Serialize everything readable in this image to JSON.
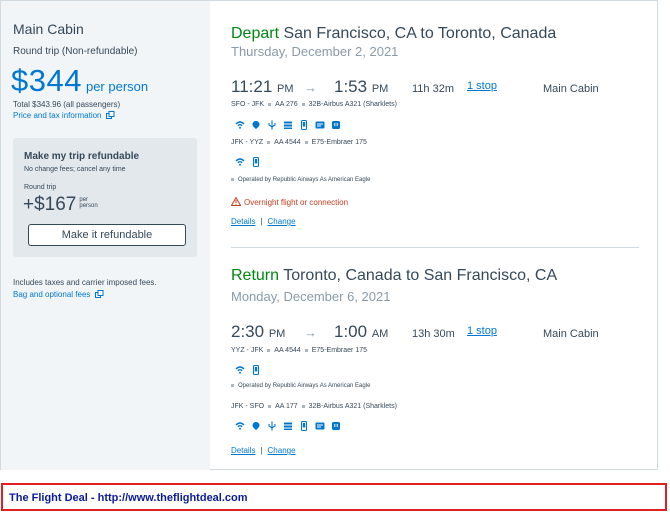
{
  "summary": {
    "cabin_title": "Main Cabin",
    "trip_type": "Round trip (Non-refundable)",
    "price": "$344",
    "per_person": "per person",
    "total": "Total $343.96 (all passengers)",
    "tax_link": "Price and tax information",
    "includes": "Includes taxes and carrier imposed fees.",
    "bag_link": "Bag and optional fees"
  },
  "refund": {
    "title": "Make my trip refundable",
    "subtitle": "No change fees; cancel any time",
    "round_trip": "Round trip",
    "price": "+$167",
    "per_line1": "per",
    "per_line2": "person",
    "button": "Make it refundable"
  },
  "depart": {
    "label": "Depart",
    "route": "San Francisco, CA to Toronto, Canada",
    "date": "Thursday, December 2, 2021",
    "dep_time": "11:21",
    "dep_ampm": "PM",
    "arrow": "→",
    "arr_time": "1:53",
    "arr_ampm": "PM",
    "duration": "11h 32m",
    "stops": "1 stop",
    "cabin": "Main Cabin",
    "leg1": {
      "route": "SFO - JFK",
      "flight": "AA 276",
      "aircraft": "32B-Airbus A321 (Sharklets)"
    },
    "leg2": {
      "route": "JFK - YYZ",
      "flight": "AA 4544",
      "aircraft": "E75-Embraer 175"
    },
    "operated": "Operated by Republic Airways As American Eagle",
    "warning": "Overnight flight or connection",
    "details": "Details",
    "change": "Change",
    "sep": "|"
  },
  "return": {
    "label": "Return",
    "route": "Toronto, Canada to San Francisco, CA",
    "date": "Monday, December 6, 2021",
    "dep_time": "2:30",
    "dep_ampm": "PM",
    "arrow": "→",
    "arr_time": "1:00",
    "arr_ampm": "AM",
    "duration": "13h 30m",
    "stops": "1 stop",
    "cabin": "Main Cabin",
    "leg1": {
      "route": "YYZ - JFK",
      "flight": "AA 4544",
      "aircraft": "E75-Embraer 175"
    },
    "operated": "Operated by Republic Airways As American Eagle",
    "leg2": {
      "route": "JFK - SFO",
      "flight": "AA 177",
      "aircraft": "32B-Airbus A321 (Sharklets)"
    },
    "details": "Details",
    "change": "Change",
    "sep": "|"
  },
  "footer": {
    "text": "The Flight Deal - http://www.theflightdeal.com"
  },
  "colors": {
    "brand_blue": "#0078d2",
    "accent_green": "#008712",
    "warning_red": "#c63e1f",
    "footer_red": "#e02020"
  }
}
